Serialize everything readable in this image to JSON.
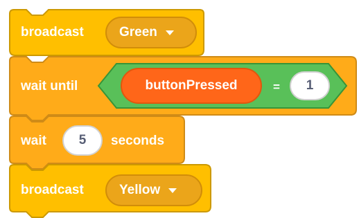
{
  "blocks": {
    "broadcast1": {
      "label": "broadcast",
      "message": "Green"
    },
    "wait_until": {
      "label": "wait until",
      "variable": "buttonPressed",
      "operator": "=",
      "value": "1"
    },
    "wait": {
      "label": "wait",
      "value": "5",
      "unit": "seconds"
    },
    "broadcast2": {
      "label": "broadcast",
      "message": "Yellow"
    }
  },
  "colors": {
    "events": "#FFBF00",
    "events_dark": "#CC9900",
    "control": "#FFAB19",
    "control_dark": "#CF8B17",
    "operators": "#59C059",
    "operators_dark": "#389438",
    "variables": "#FF8C1A"
  },
  "icons": [
    "dropdown-caret-icon"
  ]
}
